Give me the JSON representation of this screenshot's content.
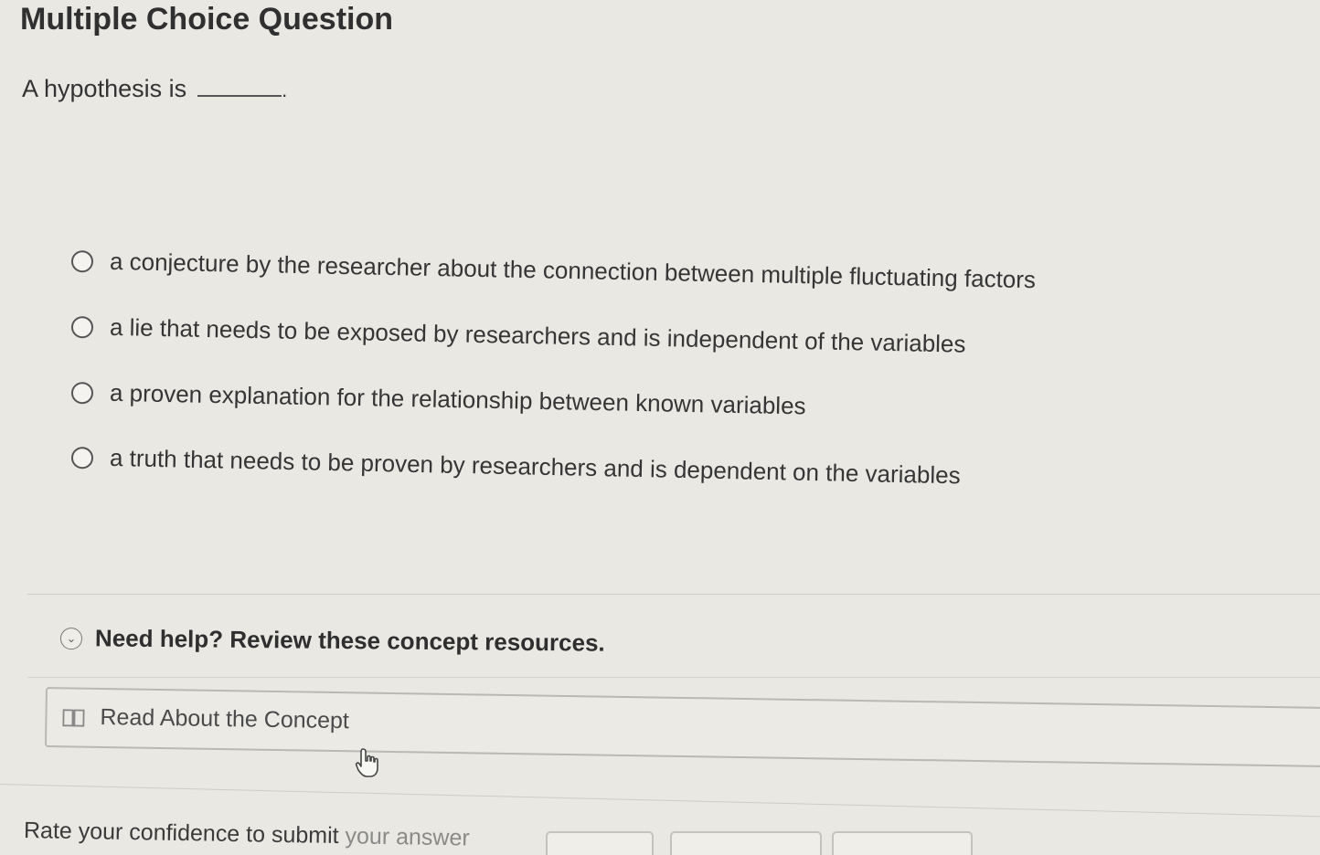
{
  "header": {
    "title": "Multiple Choice Question"
  },
  "question": {
    "prompt": "A hypothesis is",
    "prompt_end": "."
  },
  "options": [
    {
      "label": "a conjecture by the researcher about the connection between multiple fluctuating factors"
    },
    {
      "label": "a lie that needs to be exposed by researchers and is independent of the variables"
    },
    {
      "label": "a proven explanation for the relationship between known variables"
    },
    {
      "label": "a truth that needs to be proven by researchers and is dependent on the variables"
    }
  ],
  "help": {
    "heading": "Need help? Review these concept resources.",
    "resource_label": "Read About the Concept"
  },
  "footer": {
    "confidence_visible": "Rate your confidence to submit ",
    "confidence_faded": "your answer"
  },
  "icons": {
    "radio": "radio-empty-icon",
    "chevron": "chevron-down-circle-icon",
    "book": "book-icon",
    "cursor": "hand-pointer-icon"
  }
}
